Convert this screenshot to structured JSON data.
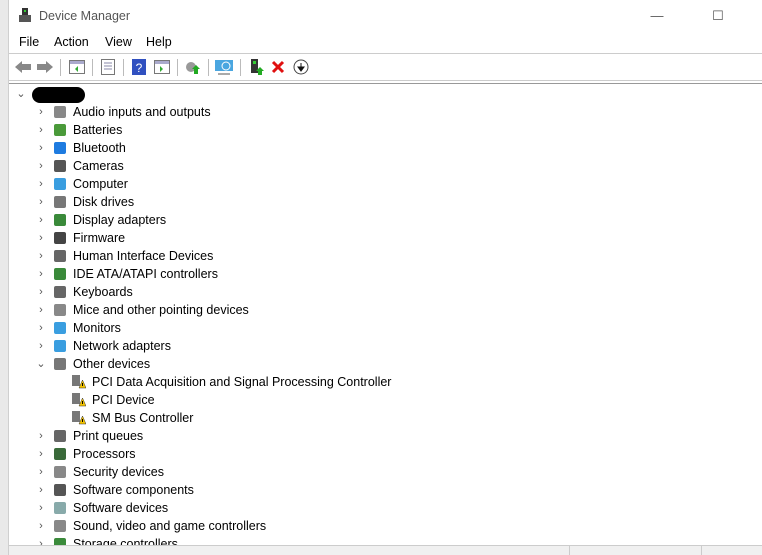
{
  "window": {
    "title": "Device Manager",
    "minimize": "—",
    "maximize": "☐",
    "close": "✕"
  },
  "menu": [
    "File",
    "Action",
    "View",
    "Help"
  ],
  "toolbar": [
    "back",
    "forward",
    "show-hide-console-tree",
    "properties",
    "help",
    "show-hide-action-pane",
    "update-driver",
    "scan-hardware",
    "enable-device",
    "uninstall-device",
    "disable-device"
  ],
  "tree": {
    "root": "",
    "categories": [
      {
        "label": "Audio inputs and outputs",
        "icon": "speaker-icon",
        "color": "#888"
      },
      {
        "label": "Batteries",
        "icon": "battery-icon",
        "color": "#4a9a3a"
      },
      {
        "label": "Bluetooth",
        "icon": "bluetooth-icon",
        "color": "#1e7be0"
      },
      {
        "label": "Cameras",
        "icon": "camera-icon",
        "color": "#555"
      },
      {
        "label": "Computer",
        "icon": "computer-icon",
        "color": "#3a9ee0"
      },
      {
        "label": "Disk drives",
        "icon": "disk-icon",
        "color": "#777"
      },
      {
        "label": "Display adapters",
        "icon": "display-adapter-icon",
        "color": "#3a8a3a"
      },
      {
        "label": "Firmware",
        "icon": "firmware-icon",
        "color": "#444"
      },
      {
        "label": "Human Interface Devices",
        "icon": "hid-icon",
        "color": "#666"
      },
      {
        "label": "IDE ATA/ATAPI controllers",
        "icon": "ide-icon",
        "color": "#3a8a3a"
      },
      {
        "label": "Keyboards",
        "icon": "keyboard-icon",
        "color": "#666"
      },
      {
        "label": "Mice and other pointing devices",
        "icon": "mouse-icon",
        "color": "#888"
      },
      {
        "label": "Monitors",
        "icon": "monitor-icon",
        "color": "#3a9ee0"
      },
      {
        "label": "Network adapters",
        "icon": "network-icon",
        "color": "#3a9ee0"
      },
      {
        "label": "Other devices",
        "icon": "unknown-device-icon",
        "color": "#777",
        "expanded": true,
        "children": [
          {
            "label": "PCI Data Acquisition and Signal Processing Controller"
          },
          {
            "label": "PCI Device"
          },
          {
            "label": "SM Bus Controller"
          }
        ]
      },
      {
        "label": "Print queues",
        "icon": "printer-icon",
        "color": "#666"
      },
      {
        "label": "Processors",
        "icon": "processor-icon",
        "color": "#3a6a3a"
      },
      {
        "label": "Security devices",
        "icon": "security-icon",
        "color": "#888"
      },
      {
        "label": "Software components",
        "icon": "software-component-icon",
        "color": "#555"
      },
      {
        "label": "Software devices",
        "icon": "software-device-icon",
        "color": "#8aa"
      },
      {
        "label": "Sound, video and game controllers",
        "icon": "sound-icon",
        "color": "#888"
      },
      {
        "label": "Storage controllers",
        "icon": "storage-icon",
        "color": "#3a8a3a"
      }
    ]
  }
}
